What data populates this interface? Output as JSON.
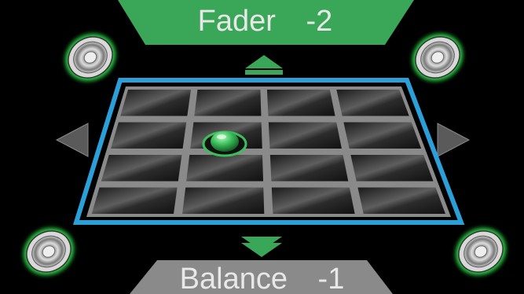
{
  "fader": {
    "label": "Fader",
    "value": "-2"
  },
  "balance": {
    "label": "Balance",
    "value": "-1"
  },
  "icons": {
    "speaker": "speaker-icon",
    "arrow_up": "arrow-up-icon",
    "arrow_down": "arrow-down-icon",
    "arrow_left": "arrow-left-icon",
    "arrow_right": "arrow-right-icon",
    "position_marker": "position-marker-icon"
  },
  "grid": {
    "rows": 4,
    "columns": 4,
    "selected_row": 2,
    "selected_column": 2
  },
  "colors": {
    "fader_banner": "#3aa657",
    "balance_banner": "#8a8a8a",
    "grid_border": "#2a9fd8",
    "marker": "#3bbf5a",
    "speaker_glow": "#2fd24a"
  }
}
